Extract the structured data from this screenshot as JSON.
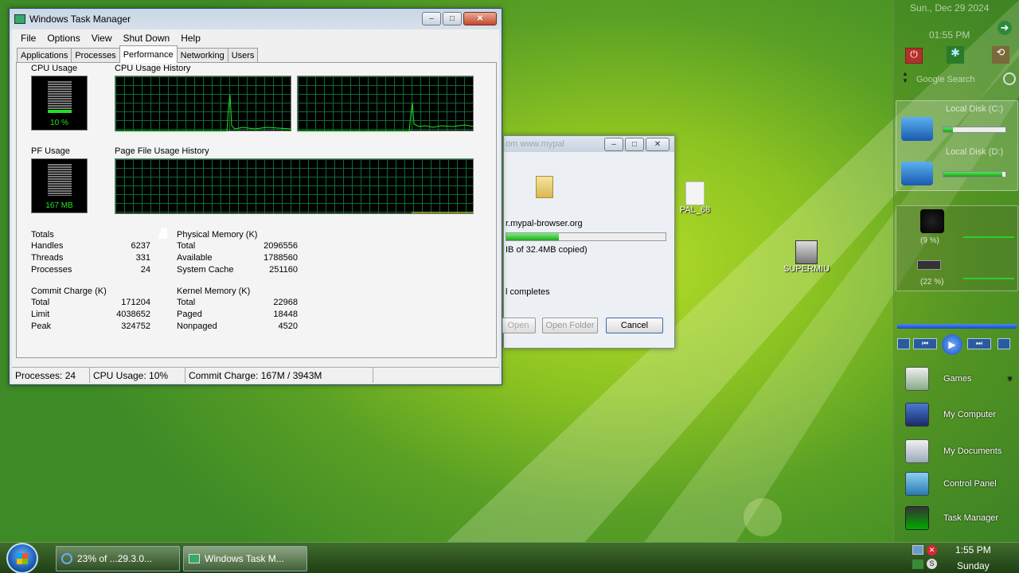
{
  "desktop": {
    "icons": [
      {
        "label": "PAL_68"
      },
      {
        "label": "SUPERMIU"
      }
    ]
  },
  "task_manager": {
    "title": "Windows Task Manager",
    "menu": [
      "File",
      "Options",
      "View",
      "Shut Down",
      "Help"
    ],
    "tabs": [
      "Applications",
      "Processes",
      "Performance",
      "Networking",
      "Users"
    ],
    "active_tab": "Performance",
    "cpu_usage_label": "CPU Usage",
    "cpu_usage_value": "10 %",
    "cpu_history_label": "CPU Usage History",
    "pf_usage_label": "PF Usage",
    "pf_usage_value": "167 MB",
    "pf_history_label": "Page File Usage History",
    "totals": {
      "heading": "Totals",
      "rows": [
        [
          "Handles",
          "6237"
        ],
        [
          "Threads",
          "331"
        ],
        [
          "Processes",
          "24"
        ]
      ]
    },
    "physical_memory": {
      "heading": "Physical Memory (K)",
      "rows": [
        [
          "Total",
          "2096556"
        ],
        [
          "Available",
          "1788560"
        ],
        [
          "System Cache",
          "251160"
        ]
      ]
    },
    "commit_charge": {
      "heading": "Commit Charge (K)",
      "rows": [
        [
          "Total",
          "171204"
        ],
        [
          "Limit",
          "4038652"
        ],
        [
          "Peak",
          "324752"
        ]
      ]
    },
    "kernel_memory": {
      "heading": "Kernel Memory (K)",
      "rows": [
        [
          "Total",
          "22968"
        ],
        [
          "Paged",
          "18448"
        ],
        [
          "Nonpaged",
          "4520"
        ]
      ]
    },
    "status": {
      "processes": "Processes: 24",
      "cpu": "CPU Usage: 10%",
      "commit": "Commit Charge: 167M / 3943M"
    }
  },
  "copy_dialog": {
    "title_partial": "om www.mypal",
    "source": "r.mypal-browser.org",
    "progress_fraction": 0.33,
    "copied_text": "IB of 32.4MB copied)",
    "note": "l completes",
    "open_label": "Open",
    "open_folder_label": "Open Folder",
    "cancel_label": "Cancel"
  },
  "taskbar": {
    "items": [
      {
        "label": "23% of ...29.3.0..."
      },
      {
        "label": "Windows Task M..."
      }
    ],
    "time": "1:55 PM",
    "day": "Sunday"
  },
  "sidebar": {
    "date": "Sun., Dec 29 2024",
    "clock": "01:55 PM",
    "search_placeholder": "Google Search",
    "disks": [
      {
        "label": "Local Disk (C:)",
        "fill": 0.15
      },
      {
        "label": "Local Disk (D:)",
        "fill": 0.95
      }
    ],
    "cpu_percent": "(9 %)",
    "ram_percent": "(22 %)",
    "links": [
      "Games",
      "My Computer",
      "My Documents",
      "Control Panel",
      "Task Manager"
    ]
  }
}
